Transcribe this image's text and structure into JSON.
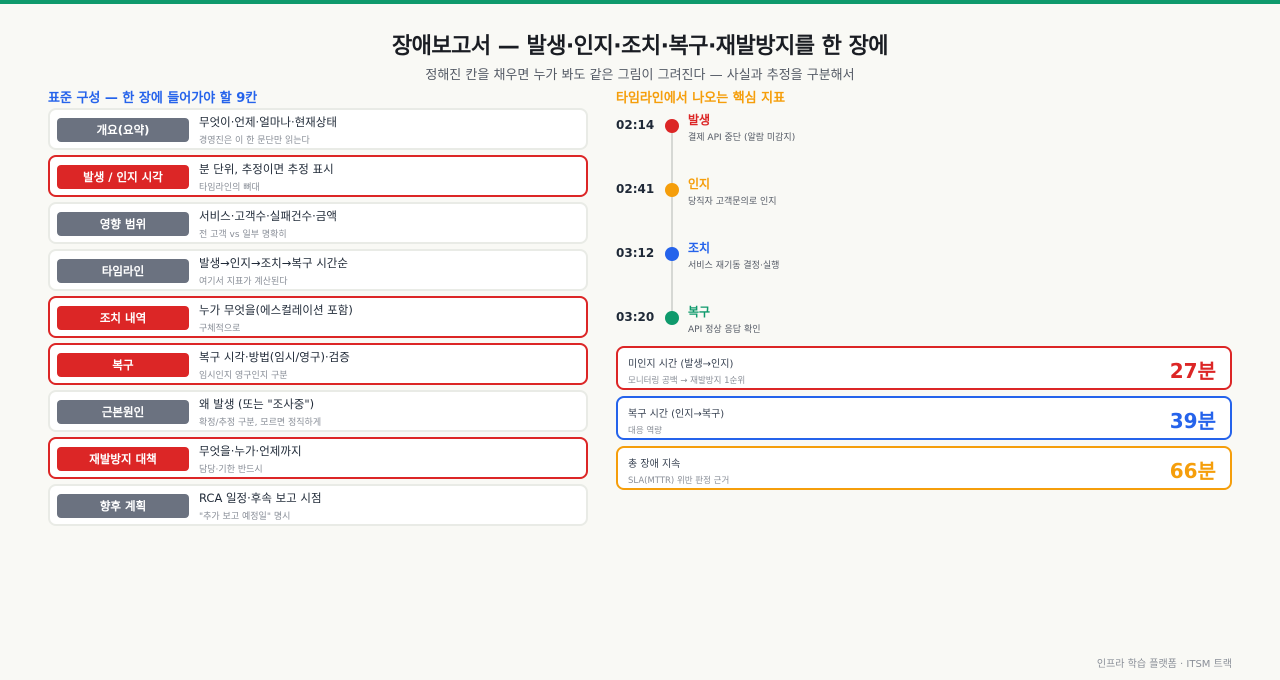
{
  "header": {
    "title": "장애보고서 — 발생·인지·조치·복구·재발방지를 한 장에",
    "subtitle": "정해진 칸을 채우면 누가 봐도 같은 그림이 그려진다 — 사실과 추정을 구분해서"
  },
  "left": {
    "title": "표준 구성 — 한 장에 들어가야 할 9칸",
    "rows": [
      {
        "badge": "개요(요약)",
        "main": "무엇이·언제·얼마나·현재상태",
        "sub": "경영진은 이 한 문단만 읽는다",
        "highlight": false
      },
      {
        "badge": "발생 / 인지 시각",
        "main": "분 단위, 추정이면 추정 표시",
        "sub": "타임라인의 뼈대",
        "highlight": true
      },
      {
        "badge": "영향 범위",
        "main": "서비스·고객수·실패건수·금액",
        "sub": "전 고객 vs 일부 명확히",
        "highlight": false
      },
      {
        "badge": "타임라인",
        "main": "발생→인지→조치→복구 시간순",
        "sub": "여기서 지표가 계산된다",
        "highlight": false
      },
      {
        "badge": "조치 내역",
        "main": "누가 무엇을(에스컬레이션 포함)",
        "sub": "구체적으로",
        "highlight": true
      },
      {
        "badge": "복구",
        "main": "복구 시각·방법(임시/영구)·검증",
        "sub": "임시인지 영구인지 구분",
        "highlight": true
      },
      {
        "badge": "근본원인",
        "main": "왜 발생 (또는 \"조사중\")",
        "sub": "확정/추정 구분, 모르면 정직하게",
        "highlight": false
      },
      {
        "badge": "재발방지 대책",
        "main": "무엇을·누가·언제까지",
        "sub": "담당·기한 반드시",
        "highlight": true
      },
      {
        "badge": "향후 계획",
        "main": "RCA 일정·후속 보고 시점",
        "sub": "\"추가 보고 예정일\" 명시",
        "highlight": false
      }
    ]
  },
  "right": {
    "title": "타임라인에서 나오는 핵심 지표",
    "timeline": [
      {
        "time": "02:14",
        "label": "발생",
        "desc": "결제 API 중단 (알람 미감지)",
        "color": "#dc2626"
      },
      {
        "time": "02:41",
        "label": "인지",
        "desc": "당직자 고객문의로 인지",
        "color": "#f59e0b"
      },
      {
        "time": "03:12",
        "label": "조치",
        "desc": "서비스 재기동 결정·실행",
        "color": "#2563eb"
      },
      {
        "time": "03:20",
        "label": "복구",
        "desc": "API 정상 응답 확인",
        "color": "#0f9a6c"
      }
    ],
    "metrics": [
      {
        "label": "미인지 시간 (발생→인지)",
        "sub": "모니터링 공백 → 재발방지 1순위",
        "value": "27분",
        "color": "#dc2626"
      },
      {
        "label": "복구 시간 (인지→복구)",
        "sub": "대응 역량",
        "value": "39분",
        "color": "#2563eb"
      },
      {
        "label": "총 장애 지속",
        "sub": "SLA(MTTR) 위반 판정 근거",
        "value": "66분",
        "color": "#f59e0b"
      }
    ]
  },
  "footer": "인프라 학습 플랫폼 · ITSM 트랙"
}
